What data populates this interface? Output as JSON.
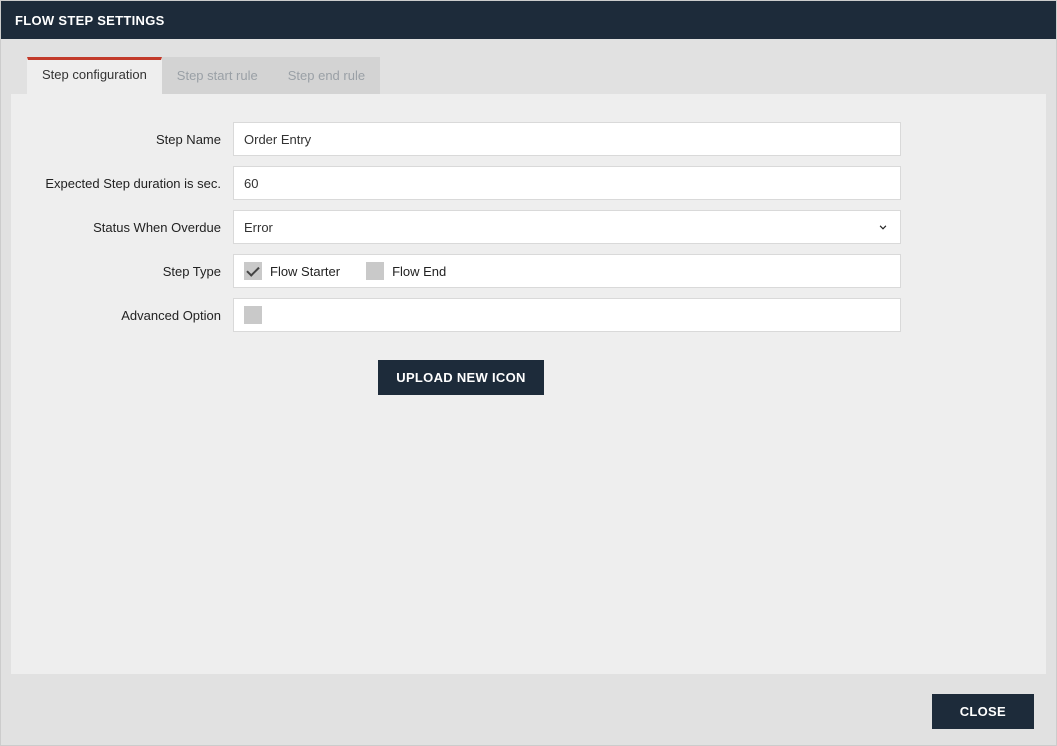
{
  "title": "FLOW STEP SETTINGS",
  "tabs": {
    "config": "Step configuration",
    "start": "Step start rule",
    "end": "Step end rule",
    "active": "config"
  },
  "form": {
    "step_name_label": "Step Name",
    "step_name_value": "Order Entry",
    "duration_label": "Expected Step duration is sec.",
    "duration_value": "60",
    "overdue_label": "Status When Overdue",
    "overdue_value": "Error",
    "step_type_label": "Step Type",
    "flow_starter_label": "Flow Starter",
    "flow_starter_checked": true,
    "flow_end_label": "Flow End",
    "flow_end_checked": false,
    "advanced_label": "Advanced Option",
    "advanced_checked": false
  },
  "buttons": {
    "upload": "UPLOAD NEW ICON",
    "close": "CLOSE"
  }
}
